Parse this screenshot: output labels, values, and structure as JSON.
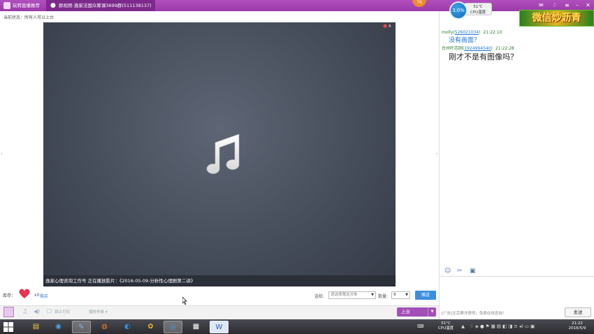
{
  "topbar": {
    "tab_live": "玩转直播推荐",
    "tab_group": "群视频-逸家法国众筹课3699群(511138137)",
    "badge": "78",
    "cpu_percent": "3.0%",
    "cpu_temp": "51℃",
    "cpu_label": "CPU温度",
    "promo": "微信炒沥青"
  },
  "left": {
    "status_label": "当前状态：所有人可以上台",
    "video_viewers": "6",
    "caption": "逸家心理咨询工作号 正在播放影片：《2016-05-09-分析性心理剧第二讲》",
    "gift_label": "库存：",
    "gift_count": "x0",
    "gift_buy": "购买",
    "send_to_label": "送给:",
    "send_to_placeholder": "请选择赠送对象",
    "qty_label": "数量:",
    "qty_value": "9",
    "send_gift_btn": "赠送",
    "toolbar_text1": "禁止打扰",
    "toolbar_text2": "播放伴奏 ▾",
    "mic_btn": "上台"
  },
  "chat": {
    "messages": [
      {
        "user": "molly(",
        "uid": "526021034",
        "close": ")",
        "time": "21:22:10",
        "text": "没有画面？"
      },
      {
        "user": "台州叶志刚(",
        "uid": "1924994540",
        "close": ")",
        "time": "21:22:28",
        "text": "刚才不是有图像吗？"
      }
    ],
    "ad": "[广告]北京赛洋律师，免费在线咨询！",
    "send_btn": "发送"
  },
  "taskbar": {
    "temp": "51°C",
    "temp_label": "CPU温度",
    "time": "21:22",
    "date": "2016/5/9"
  }
}
